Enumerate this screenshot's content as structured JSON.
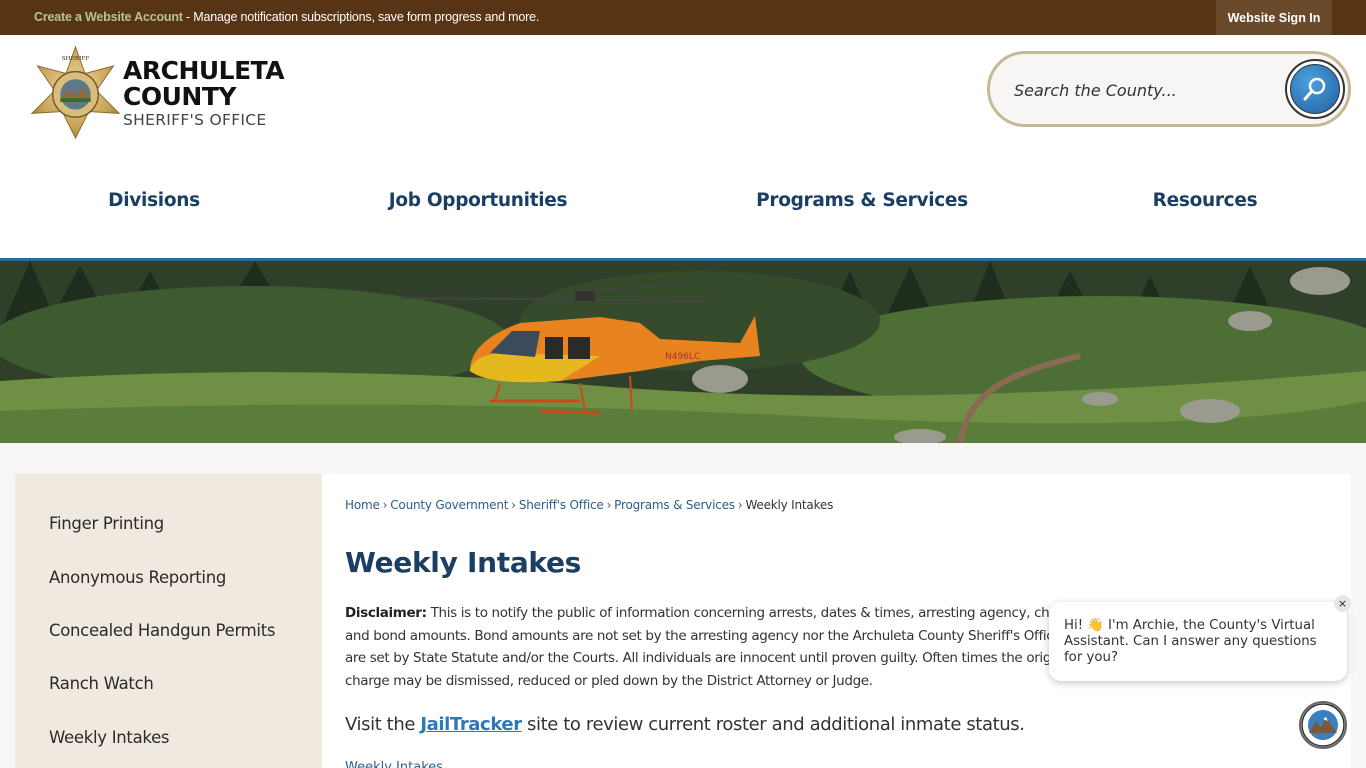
{
  "topbar": {
    "account_link": "Create a Website Account",
    "account_msg": " - Manage notification subscriptions, save form progress and more.",
    "signin_label": "Website Sign In"
  },
  "logo": {
    "line1": "ARCHULETA",
    "line2": "COUNTY",
    "line3": "SHERIFF'S OFFICE",
    "badge_icon": "sheriff-star-badge-icon"
  },
  "search": {
    "placeholder": "Search the County...",
    "button_icon": "magnifier-icon"
  },
  "nav": {
    "items": [
      {
        "label": "Divisions"
      },
      {
        "label": "Job Opportunities"
      },
      {
        "label": "Programs & Services"
      },
      {
        "label": "Resources"
      }
    ]
  },
  "hero": {
    "description": "Orange helicopter (N496LC) landed in a mountain meadow"
  },
  "sidebar": {
    "items": [
      {
        "label": "Finger Printing"
      },
      {
        "label": "Anonymous Reporting"
      },
      {
        "label": "Concealed Handgun Permits"
      },
      {
        "label": "Ranch Watch"
      },
      {
        "label": "Weekly Intakes"
      }
    ]
  },
  "breadcrumb": {
    "items": [
      "Home",
      "County Government",
      "Sheriff's Office",
      "Programs & Services"
    ],
    "current": "Weekly Intakes",
    "separator": "›"
  },
  "main": {
    "title": "Weekly Intakes",
    "disclaimer_label": "Disclaimer:",
    "disclaimer_text": " This is to notify the public of information concerning arrests, dates & times, arresting agency, charges and bond amounts. Bond amounts are not set by the arresting agency nor the Archuleta County Sheriff's Office, they are set by State Statute and/or the Courts. All individuals are innocent until proven guilty. Often times the original charge may be dismissed, reduced or pled down by the District Attorney or Judge.",
    "visit_prefix": "Visit the ",
    "visit_link": "JailTracker",
    "visit_suffix": " site to review current roster and additional inmate status.",
    "bottom_link": "Weekly Intakes"
  },
  "chat": {
    "message": "Hi! 👋 I'm Archie, the County's Virtual Assistant. Can I answer any questions for you?",
    "close_label": "×"
  },
  "colors": {
    "topbar": "#573514",
    "nav_text": "#1a3f63",
    "accent_rule": "#2d6a93",
    "sidebar_bg": "#efe9df",
    "link": "#2c78b8"
  }
}
